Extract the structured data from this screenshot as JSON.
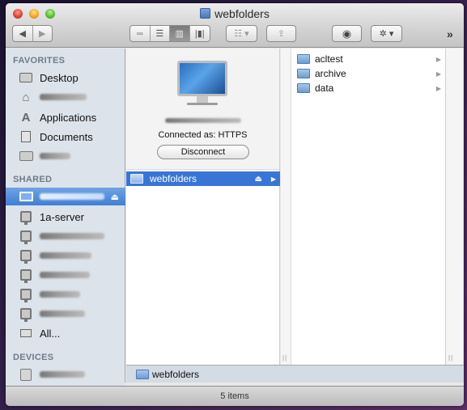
{
  "window": {
    "title": "webfolders",
    "title_icon": "network-volume-icon"
  },
  "toolbar": {
    "back_icon": "back-arrow-icon",
    "forward_icon": "forward-arrow-icon",
    "view_modes": [
      {
        "name": "icon-view",
        "glyph": "▫▫",
        "active": false
      },
      {
        "name": "list-view",
        "glyph": "☰",
        "active": false
      },
      {
        "name": "column-view",
        "glyph": "▥",
        "active": true
      },
      {
        "name": "coverflow-view",
        "glyph": "|▮|",
        "active": false
      }
    ],
    "arrange_glyph": "☷ ▾",
    "share_glyph": "⇪",
    "quicklook_glyph": "◉",
    "action_glyph": "✲ ▾",
    "overflow_glyph": "»"
  },
  "sidebar": {
    "favorites_heading": "FAVORITES",
    "favorites": [
      {
        "label": "Desktop",
        "icon": "desktop-icon",
        "redacted": false
      },
      {
        "label": "",
        "icon": "home-icon",
        "redacted": true
      },
      {
        "label": "Applications",
        "icon": "applications-icon",
        "redacted": false
      },
      {
        "label": "Documents",
        "icon": "documents-icon",
        "redacted": false
      },
      {
        "label": "",
        "icon": "folder-icon",
        "redacted": true
      }
    ],
    "shared_heading": "SHARED",
    "shared": [
      {
        "label": "",
        "icon": "monitor-icon",
        "redacted": true,
        "selected": true,
        "eject": "⏏"
      },
      {
        "label": "1a-server",
        "icon": "server-icon",
        "redacted": false
      },
      {
        "label": "",
        "icon": "server-icon",
        "redacted": true
      },
      {
        "label": "",
        "icon": "server-icon",
        "redacted": true
      },
      {
        "label": "",
        "icon": "server-icon",
        "redacted": true
      },
      {
        "label": "",
        "icon": "server-icon",
        "redacted": true
      },
      {
        "label": "",
        "icon": "server-icon",
        "redacted": true
      },
      {
        "label": "All...",
        "icon": "network-icon",
        "redacted": false
      }
    ],
    "devices_heading": "DEVICES",
    "devices": [
      {
        "label": "",
        "icon": "hard-disk-icon",
        "redacted": true
      }
    ]
  },
  "server_panel": {
    "connected_text": "Connected as: HTTPS",
    "disconnect_label": "Disconnect"
  },
  "column1": {
    "items": [
      {
        "label": "webfolders",
        "selected": true,
        "eject": "⏏",
        "arrow": "▶"
      }
    ]
  },
  "column2": {
    "items": [
      {
        "label": "acltest",
        "arrow": "▶"
      },
      {
        "label": "archive",
        "arrow": "▶"
      },
      {
        "label": "data",
        "arrow": "▶"
      }
    ]
  },
  "pathbar": {
    "label": "webfolders"
  },
  "status": {
    "text": "5 items"
  },
  "resize_glyph": "||"
}
